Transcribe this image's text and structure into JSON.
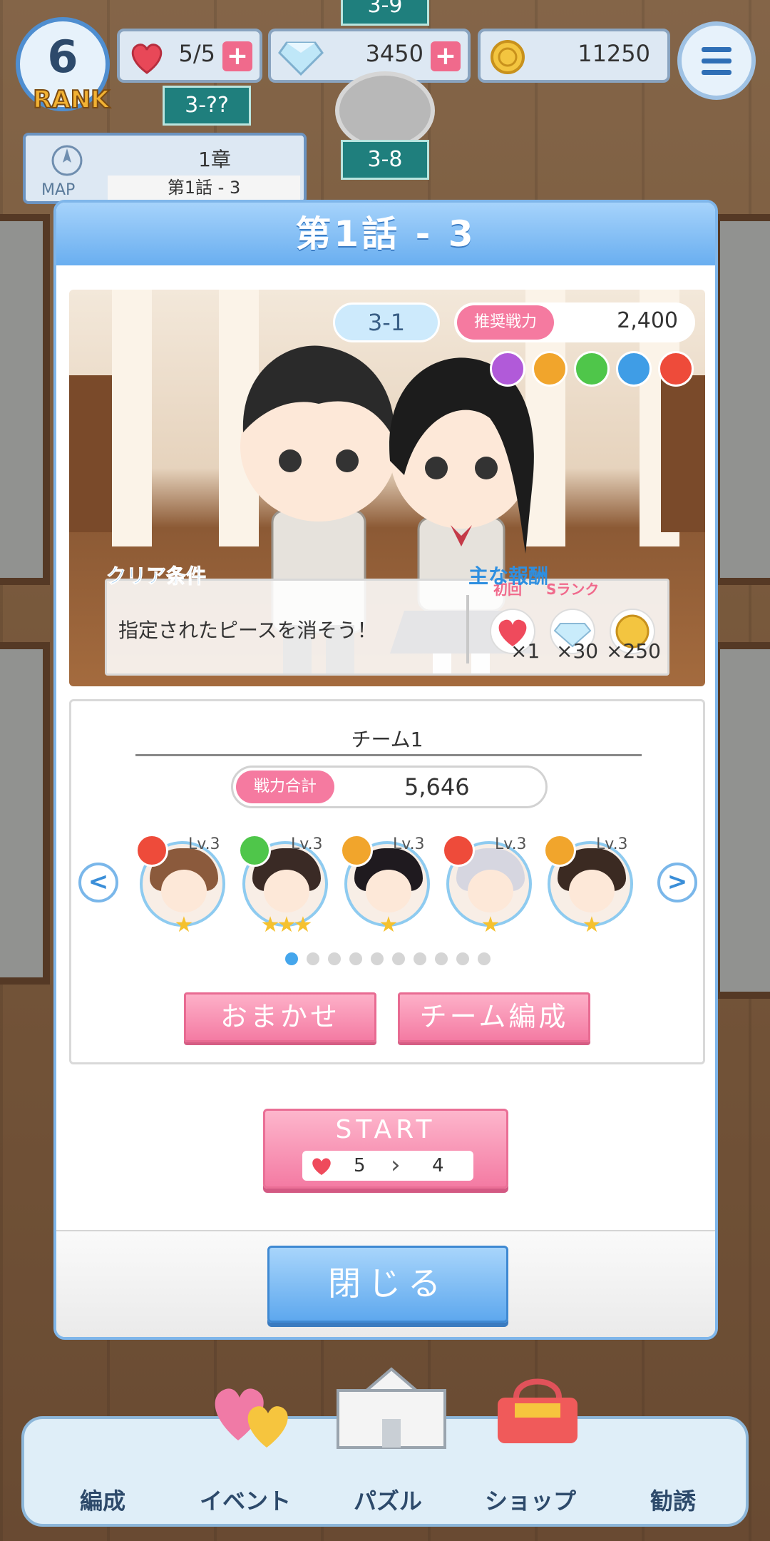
{
  "hud": {
    "rank_number": "6",
    "rank_label": "RANK",
    "hearts": "5/5",
    "gems": "3450",
    "coins": "11250",
    "stage_tags": [
      "3-9",
      "3-??",
      "3-8"
    ]
  },
  "map_panel": {
    "chapter": "1章",
    "episode": "第1話 - 3",
    "map_label": "MAP"
  },
  "modal": {
    "title": "第1話 - 3",
    "stage_id": "3-1",
    "recommended_power_label": "推奨戦力",
    "recommended_power_value": "2,400",
    "attributes": [
      "#b15ad9",
      "#f1a52c",
      "#4fc64a",
      "#3f9de6",
      "#ee4b3a"
    ],
    "clear_condition_title": "クリア条件",
    "clear_condition_text": "指定されたピースを消そう！",
    "reward_title": "主な報酬",
    "rewards": [
      {
        "tag": "初回",
        "icon": "heart-icon",
        "qty": "×1"
      },
      {
        "tag": "Sランク",
        "icon": "gem-icon",
        "qty": "×30"
      },
      {
        "tag": "",
        "icon": "coin-icon",
        "qty": "×250"
      }
    ]
  },
  "team": {
    "name": "チーム1",
    "total_power_label": "戦力合計",
    "total_power_value": "5,646",
    "members": [
      {
        "level": "Lv.3",
        "attr": "#ee4b3a",
        "hair": "#8b5a3c",
        "stars": "★"
      },
      {
        "level": "Lv.3",
        "attr": "#4fc64a",
        "hair": "#3a2a25",
        "stars": "★★★"
      },
      {
        "level": "Lv.3",
        "attr": "#f1a52c",
        "hair": "#1f1a1f",
        "stars": "★"
      },
      {
        "level": "Lv.3",
        "attr": "#ee4b3a",
        "hair": "#d6d6e0",
        "stars": "★"
      },
      {
        "level": "Lv.3",
        "attr": "#f1a52c",
        "hair": "#3b2a22",
        "stars": "★"
      }
    ],
    "page_count": 10,
    "active_page": 0,
    "prev_label": "<",
    "next_label": ">",
    "auto_label": "おまかせ",
    "edit_label": "チーム編成"
  },
  "start": {
    "label": "START",
    "stamina_from": "5",
    "stamina_to": "4"
  },
  "close_label": "閉じる",
  "bottom_nav": [
    {
      "label": "編成"
    },
    {
      "label": "イベント"
    },
    {
      "label": "パズル"
    },
    {
      "label": "ショップ",
      "badge": "SHOP"
    },
    {
      "label": "勧誘"
    }
  ]
}
